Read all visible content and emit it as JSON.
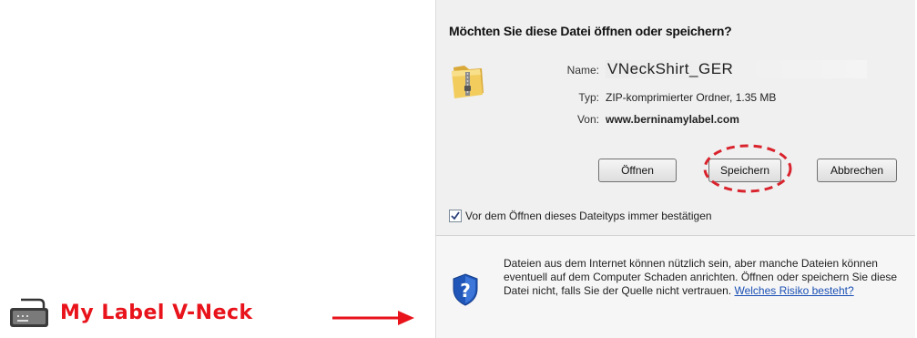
{
  "left_label": {
    "text": "My Label V-Neck",
    "color": "#e8131b",
    "icon": "sewing-machine-icon"
  },
  "arrow": {
    "color": "#e8131b",
    "icon": "arrow-right-icon"
  },
  "dialog": {
    "question": "Möchten Sie diese Datei öffnen oder speichern?",
    "file_icon": "zip-folder-icon",
    "fields": {
      "name_key": "Name:",
      "name_val": "VNeckShirt_GER",
      "type_key": "Typ:",
      "type_val": "ZIP-komprimierter Ordner, 1.35 MB",
      "from_key": "Von:",
      "from_val": "www.berninamylabel.com"
    },
    "buttons": {
      "open": "Öffnen",
      "save": "Speichern",
      "cancel": "Abbrechen"
    },
    "highlight_color": "#d9232d",
    "checkbox": {
      "checked": true,
      "label": "Vor dem Öffnen dieses Dateityps immer bestätigen"
    },
    "warning": {
      "icon": "shield-question-icon",
      "text": "Dateien aus dem Internet können nützlich sein, aber manche Dateien können eventuell auf dem Computer Schaden anrichten. Öffnen oder speichern Sie diese Datei nicht, falls Sie der Quelle nicht vertrauen.",
      "link": "Welches Risiko besteht?"
    }
  }
}
